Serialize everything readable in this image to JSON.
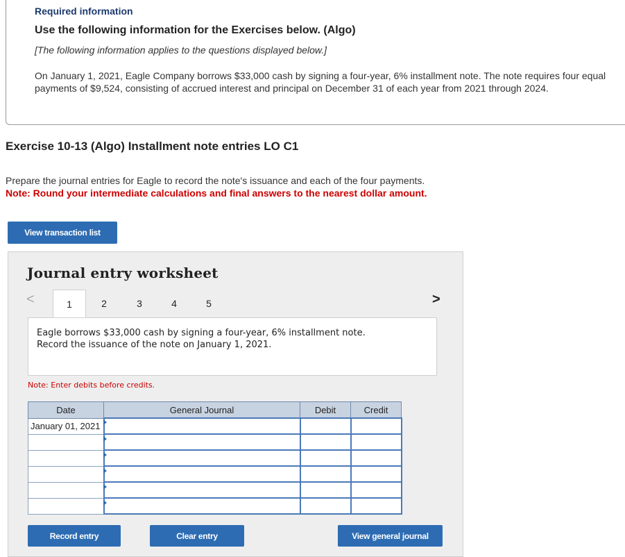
{
  "header": {
    "required_info": "Required information",
    "use_info": "Use the following information for the Exercises below. (Algo)",
    "applies": "[The following information applies to the questions displayed below.]",
    "paragraph": "On January 1, 2021, Eagle Company borrows $33,000 cash by signing a four-year, 6% installment note. The note requires four equal payments of $9,524, consisting of accrued interest and principal on December 31 of each year from 2021 through 2024."
  },
  "exercise": {
    "title": "Exercise 10-13 (Algo) Installment note entries LO C1",
    "prepare": "Prepare the journal entries for Eagle to record the note's issuance and each of the four payments.",
    "round_note": "Note: Round your intermediate calculations and final answers to the nearest dollar amount."
  },
  "buttons": {
    "view_transaction_list": "View transaction list",
    "record_entry": "Record entry",
    "clear_entry": "Clear entry",
    "view_general_journal": "View general journal"
  },
  "worksheet": {
    "title": "Journal entry worksheet",
    "tabs": [
      "1",
      "2",
      "3",
      "4",
      "5"
    ],
    "active_tab": "1",
    "description_line1": "Eagle borrows $33,000 cash by signing a four-year, 6% installment note.",
    "description_line2": "Record the issuance of the note on January 1, 2021.",
    "note_debits": "Note: Enter debits before credits.",
    "columns": [
      "Date",
      "General Journal",
      "Debit",
      "Credit"
    ],
    "rows": [
      {
        "date": "January 01, 2021",
        "account": "",
        "debit": "",
        "credit": ""
      },
      {
        "date": "",
        "account": "",
        "debit": "",
        "credit": ""
      },
      {
        "date": "",
        "account": "",
        "debit": "",
        "credit": ""
      },
      {
        "date": "",
        "account": "",
        "debit": "",
        "credit": ""
      },
      {
        "date": "",
        "account": "",
        "debit": "",
        "credit": ""
      },
      {
        "date": "",
        "account": "",
        "debit": "",
        "credit": ""
      }
    ]
  },
  "colors": {
    "button_blue": "#2d6cb3",
    "note_red": "#cc0000",
    "header_blue": "#1d3a6e"
  },
  "icons": {
    "nav_prev": "chevron-left-icon",
    "nav_next": "chevron-right-icon"
  }
}
